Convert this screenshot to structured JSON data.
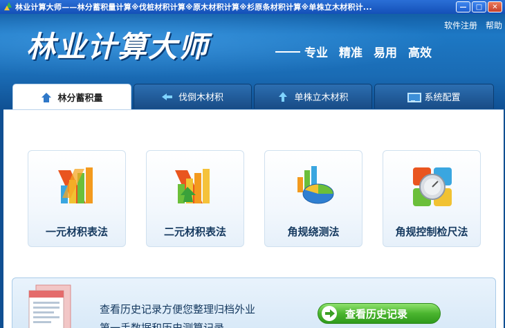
{
  "window": {
    "title": "林业计算大师——林分蓄积量计算※伐桩材积计算※原木材积计算※杉原条材积计算※单株立木材积计...",
    "minimize_glyph": "—",
    "maximize_glyph": "□",
    "close_glyph": "✕"
  },
  "header": {
    "app_title": "林业计算大师",
    "slogan_items": [
      "专业",
      "精准",
      "易用",
      "高效"
    ],
    "links": [
      "软件注册",
      "帮助"
    ]
  },
  "tabs": [
    {
      "label": "林分蓄积量",
      "icon": "home-icon",
      "active": true
    },
    {
      "label": "伐倒木材积",
      "icon": "arrow-left-icon",
      "active": false
    },
    {
      "label": "单株立木材积",
      "icon": "arrow-up-icon",
      "active": false
    },
    {
      "label": "系统配置",
      "icon": "monitor-icon",
      "active": false
    }
  ],
  "cards": [
    {
      "label": "一元材积表法",
      "icon": "bar-chart-icon"
    },
    {
      "label": "二元材积表法",
      "icon": "bar-chart-arrow-icon"
    },
    {
      "label": "角规绕测法",
      "icon": "pie-chart-icon"
    },
    {
      "label": "角规控制检尺法",
      "icon": "gauge-icon"
    }
  ],
  "history": {
    "line1": "查看历史记录方便您整理归档外业",
    "line2": "第一手数据和历史测算记录",
    "button_label": "查看历史记录"
  },
  "colors": {
    "header_blue": "#1d78c4",
    "titlebar_blue": "#1450b8",
    "button_green": "#4bb52f",
    "card_text": "#163a60"
  }
}
